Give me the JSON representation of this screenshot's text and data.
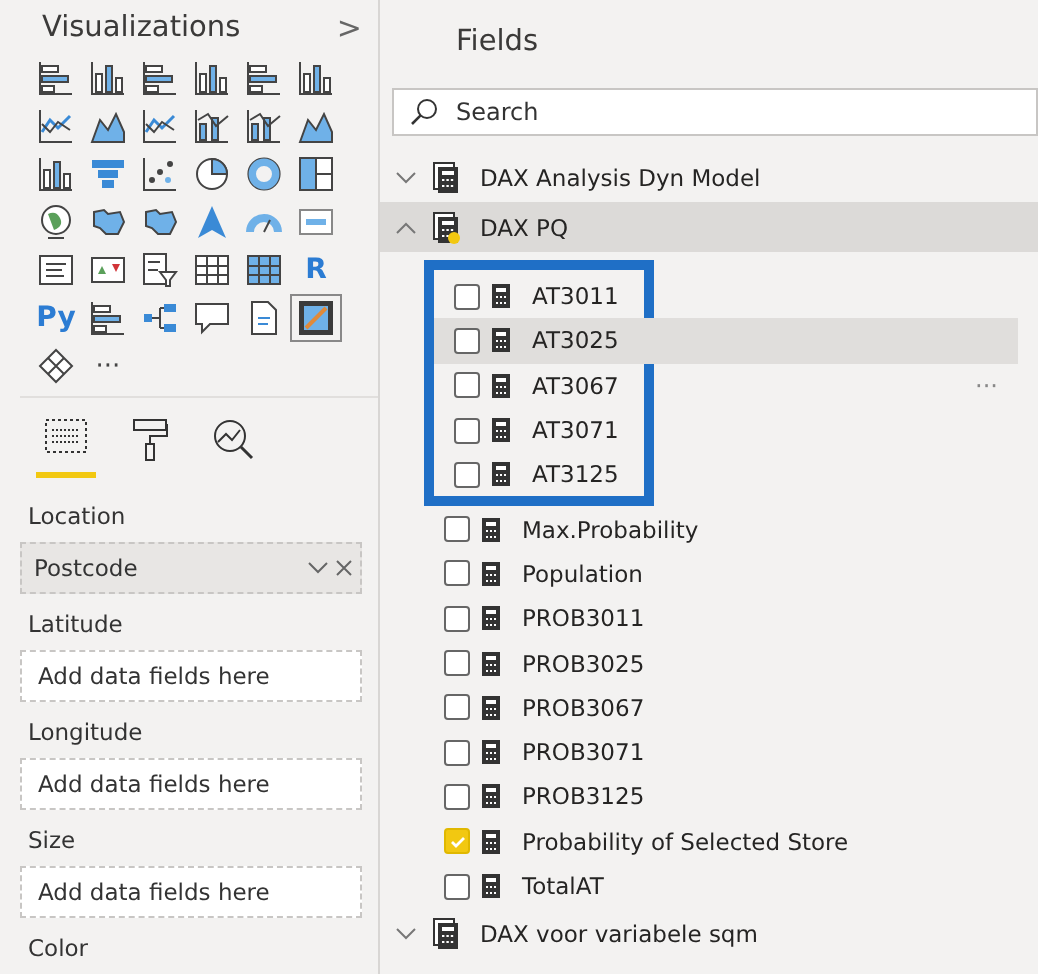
{
  "visualizations": {
    "title": "Visualizations",
    "collapse_glyph": ">",
    "visuals": [
      {
        "kind": "hbar",
        "selected": false
      },
      {
        "kind": "col",
        "selected": false
      },
      {
        "kind": "hbar",
        "selected": false
      },
      {
        "kind": "col",
        "selected": false
      },
      {
        "kind": "hbar",
        "selected": false
      },
      {
        "kind": "col",
        "selected": false
      },
      {
        "kind": "line",
        "selected": false
      },
      {
        "kind": "area",
        "selected": false
      },
      {
        "kind": "line",
        "selected": false
      },
      {
        "kind": "combo",
        "selected": false
      },
      {
        "kind": "combo",
        "selected": false
      },
      {
        "kind": "area",
        "selected": false
      },
      {
        "kind": "col",
        "selected": false
      },
      {
        "kind": "funnel",
        "selected": false
      },
      {
        "kind": "scatter",
        "selected": false
      },
      {
        "kind": "pie",
        "selected": false
      },
      {
        "kind": "donut",
        "selected": false
      },
      {
        "kind": "treemap",
        "selected": false
      },
      {
        "kind": "globe",
        "selected": false
      },
      {
        "kind": "map",
        "selected": false
      },
      {
        "kind": "map",
        "selected": false
      },
      {
        "kind": "arrow",
        "selected": false
      },
      {
        "kind": "gauge",
        "selected": false
      },
      {
        "kind": "card",
        "selected": false
      },
      {
        "kind": "textbox",
        "selected": false
      },
      {
        "kind": "kpi",
        "selected": false
      },
      {
        "kind": "slicer",
        "selected": false
      },
      {
        "kind": "table",
        "selected": false
      },
      {
        "kind": "matrix",
        "selected": false
      },
      {
        "kind": "letter",
        "label": "R",
        "selected": false
      },
      {
        "kind": "letter",
        "label": "Py",
        "selected": false
      },
      {
        "kind": "hbar",
        "selected": false
      },
      {
        "kind": "tree",
        "selected": false
      },
      {
        "kind": "speech",
        "selected": false
      },
      {
        "kind": "page",
        "selected": false
      },
      {
        "kind": "custom",
        "selected": true
      },
      {
        "kind": "shape",
        "selected": false
      },
      {
        "kind": "more",
        "label": "···",
        "selected": false
      }
    ],
    "tabs": [
      {
        "kind": "fields",
        "selected": true
      },
      {
        "kind": "format",
        "selected": false
      },
      {
        "kind": "analytics",
        "selected": false
      }
    ],
    "wells": [
      {
        "label": "Location",
        "value": "Postcode"
      },
      {
        "label": "Latitude",
        "placeholder": "Add data fields here"
      },
      {
        "label": "Longitude",
        "placeholder": "Add data fields here"
      },
      {
        "label": "Size",
        "placeholder": "Add data fields here"
      },
      {
        "label": "Color"
      }
    ]
  },
  "fields": {
    "title": "Fields",
    "search": {
      "placeholder": "Search"
    },
    "tables": [
      {
        "name": "DAX Analysis Dyn Model",
        "expanded": false,
        "selected": false
      },
      {
        "name": "DAX PQ",
        "expanded": true,
        "selected": true,
        "boxed_fields": [
          {
            "name": "AT3011",
            "checked": false,
            "hovered": false
          },
          {
            "name": "AT3025",
            "checked": false,
            "hovered": true
          },
          {
            "name": "AT3067",
            "checked": false,
            "hovered": false,
            "more": "···"
          },
          {
            "name": "AT3071",
            "checked": false,
            "hovered": false
          },
          {
            "name": "AT3125",
            "checked": false,
            "hovered": false
          }
        ],
        "fields": [
          {
            "name": "Max.Probability",
            "checked": false,
            "hovered": false
          },
          {
            "name": "Population",
            "checked": false,
            "hovered": false
          },
          {
            "name": "PROB3011",
            "checked": false,
            "hovered": false
          },
          {
            "name": "PROB3025",
            "checked": false,
            "hovered": false
          },
          {
            "name": "PROB3067",
            "checked": false,
            "hovered": false
          },
          {
            "name": "PROB3071",
            "checked": false,
            "hovered": false
          },
          {
            "name": "PROB3125",
            "checked": false,
            "hovered": false
          },
          {
            "name": "Probability of Selected Store",
            "checked": true,
            "hovered": false
          },
          {
            "name": "TotalAT",
            "checked": false,
            "hovered": false
          }
        ]
      },
      {
        "name": "DAX voor variabele sqm",
        "expanded": false,
        "selected": false
      }
    ]
  }
}
